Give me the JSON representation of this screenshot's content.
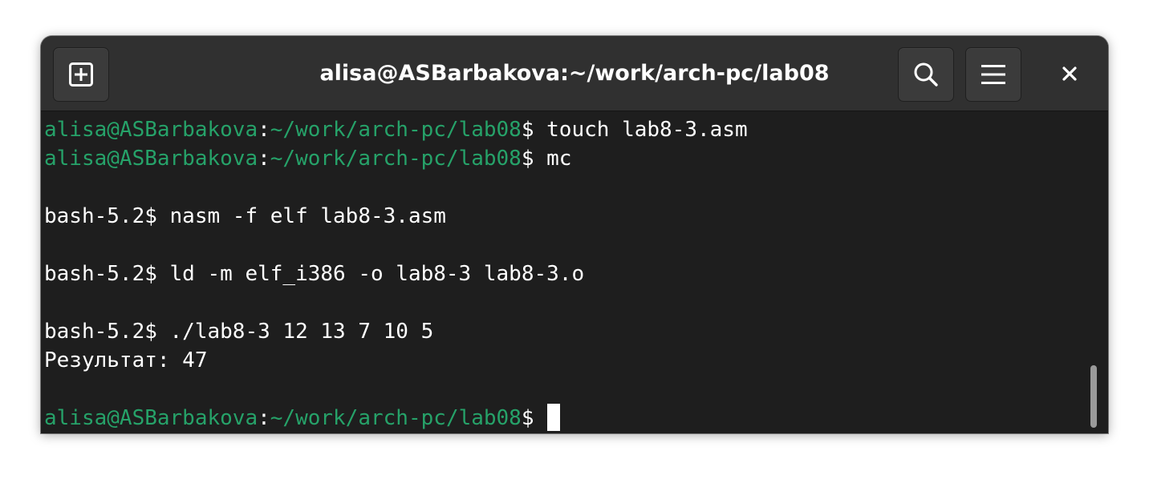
{
  "window": {
    "title": "alisa@ASBarbakova:~/work/arch-pc/lab08"
  },
  "titlebar": {
    "new_tab_icon": "new-tab-icon",
    "search_icon": "search-icon",
    "menu_icon": "hamburger-menu-icon",
    "close_icon": "close-icon"
  },
  "colors": {
    "prompt_green": "#26a269",
    "background": "#1e1e1e",
    "titlebar": "#303030",
    "text": "#ffffff"
  },
  "terminal": {
    "lines": [
      {
        "user": "alisa@ASBarbakova",
        "colon": ":",
        "path": "~/work/arch-pc/lab08",
        "cmd": "$ touch lab8-3.asm"
      },
      {
        "user": "alisa@ASBarbakova",
        "colon": ":",
        "path": "~/work/arch-pc/lab08",
        "cmd": "$ mc"
      },
      {
        "text": "bash-5.2$ nasm -f elf lab8-3.asm"
      },
      {
        "text": "bash-5.2$ ld -m elf_i386 -o lab8-3 lab8-3.o"
      },
      {
        "text": "bash-5.2$ ./lab8-3 12 13 7 10 5"
      },
      {
        "text": "Результат: 47"
      },
      {
        "user": "alisa@ASBarbakova",
        "colon": ":",
        "path": "~/work/arch-pc/lab08",
        "cmd": "$ "
      }
    ]
  }
}
